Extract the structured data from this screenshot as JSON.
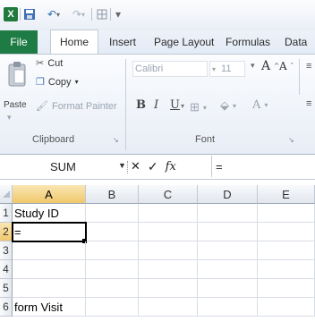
{
  "quick_access": {
    "logo": "X",
    "save_icon": "save-icon",
    "undo_icon": "undo-icon",
    "redo_icon": "redo-icon"
  },
  "tabs": [
    {
      "label": "File"
    },
    {
      "label": "Home"
    },
    {
      "label": "Insert"
    },
    {
      "label": "Page Layout"
    },
    {
      "label": "Formulas"
    },
    {
      "label": "Data"
    }
  ],
  "clipboard": {
    "paste": "Paste",
    "cut": "Cut",
    "copy": "Copy",
    "format_painter": "Format Painter",
    "group_label": "Clipboard"
  },
  "font": {
    "name": "Calibri",
    "size": "11",
    "grow": "A",
    "shrink": "A",
    "bold": "B",
    "italic": "I",
    "underline": "U",
    "color_a": "A",
    "group_label": "Font"
  },
  "formula_bar": {
    "name_box": "SUM",
    "cancel": "✕",
    "enter": "✓",
    "fx": "fx",
    "content": "="
  },
  "grid": {
    "columns": [
      "A",
      "B",
      "C",
      "D",
      "E"
    ],
    "rows": [
      "1",
      "2",
      "3",
      "4",
      "5",
      "6"
    ],
    "cells": {
      "A1": "Study ID",
      "A2": "=",
      "A6": "form Visit"
    }
  },
  "colors": {
    "file_tab": "#1e7b43",
    "active_header": "#f0c86b"
  }
}
